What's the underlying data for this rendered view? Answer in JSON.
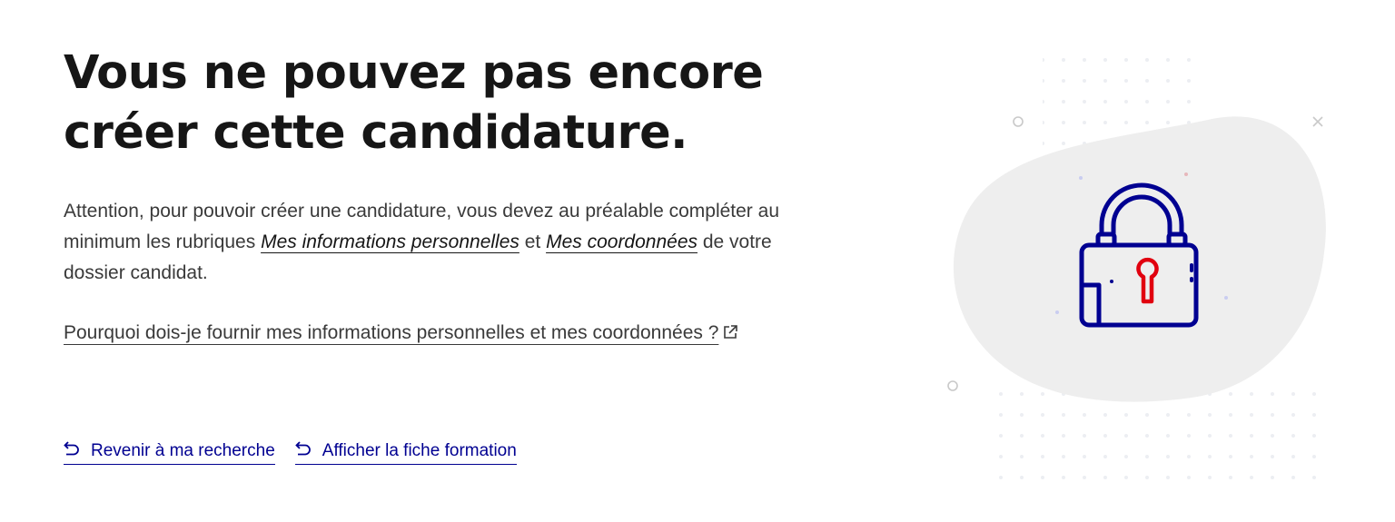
{
  "heading": {
    "line1": "Vous ne pouvez pas encore",
    "line2": "créer cette candidature."
  },
  "intro": {
    "text_before": "Attention, pour pouvoir créer une candidature, vous devez au préalable compléter au minimum les rubriques ",
    "link1": "Mes informations personnelles",
    "text_middle": " et ",
    "link2": "Mes coordonnées",
    "text_after": " de votre dossier candidat."
  },
  "why_link": {
    "label": "Pourquoi dois-je fournir mes informations personnelles et mes coordonnées ?",
    "icon": "external-link-icon"
  },
  "actions": {
    "back_search": {
      "label": "Revenir à ma recherche",
      "icon": "undo-arrow-icon"
    },
    "show_training": {
      "label": "Afficher la fiche formation",
      "icon": "undo-arrow-icon"
    }
  },
  "illustration": {
    "icon": "padlock-icon",
    "colors": {
      "outline": "#000091",
      "keyhole": "#e1000f",
      "blob": "#eeeeee"
    }
  }
}
